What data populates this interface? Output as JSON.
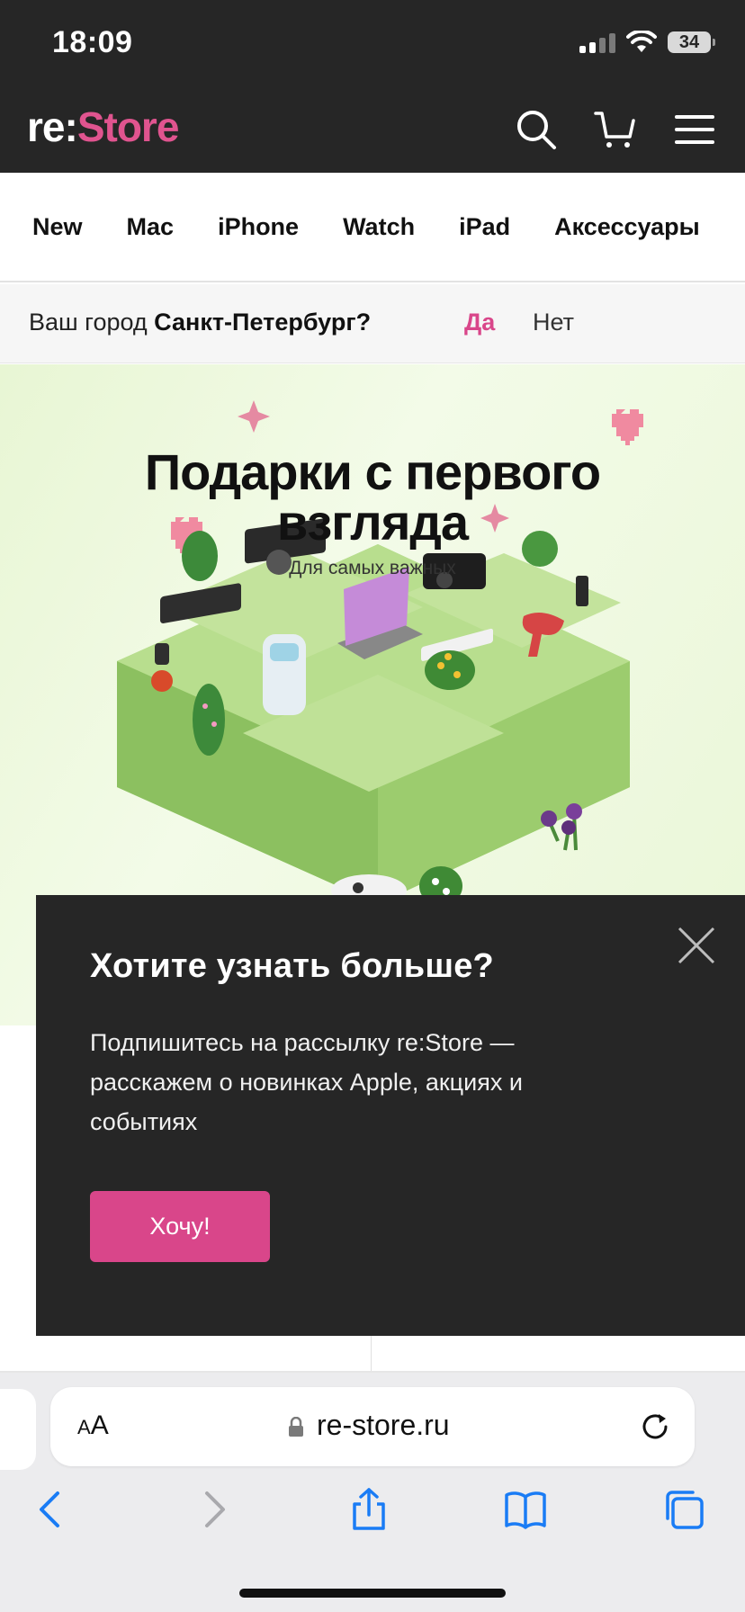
{
  "status_bar": {
    "time": "18:09",
    "battery": "34"
  },
  "header": {
    "logo_re": "re:",
    "logo_store": "Store"
  },
  "nav": {
    "items": [
      "New",
      "Mac",
      "iPhone",
      "Watch",
      "iPad",
      "Аксессуары"
    ]
  },
  "city": {
    "question_prefix": "Ваш город",
    "city_name": "Санкт-Петербург?",
    "yes": "Да",
    "no": "Нет"
  },
  "banner": {
    "title_line1": "Подарки с первого",
    "title_line2": "взгляда",
    "subtitle": "Для самых важных"
  },
  "popup": {
    "title": "Хотите узнать больше?",
    "text": "Подпишитесь на рассылку re:Store — расскажем о новинках Apple, акциях и событиях",
    "button": "Хочу!"
  },
  "browser": {
    "aa_label_small": "A",
    "aa_label_big": "A",
    "url": "re-store.ru"
  },
  "colors": {
    "brand_pink": "#d9468a",
    "header_bg": "#262626",
    "banner_green": "#a7d47a"
  },
  "icons": [
    "search-icon",
    "cart-icon",
    "menu-icon",
    "close-icon",
    "lock-icon",
    "reload-icon",
    "back-icon",
    "forward-icon",
    "share-icon",
    "bookmarks-icon",
    "tabs-icon"
  ]
}
